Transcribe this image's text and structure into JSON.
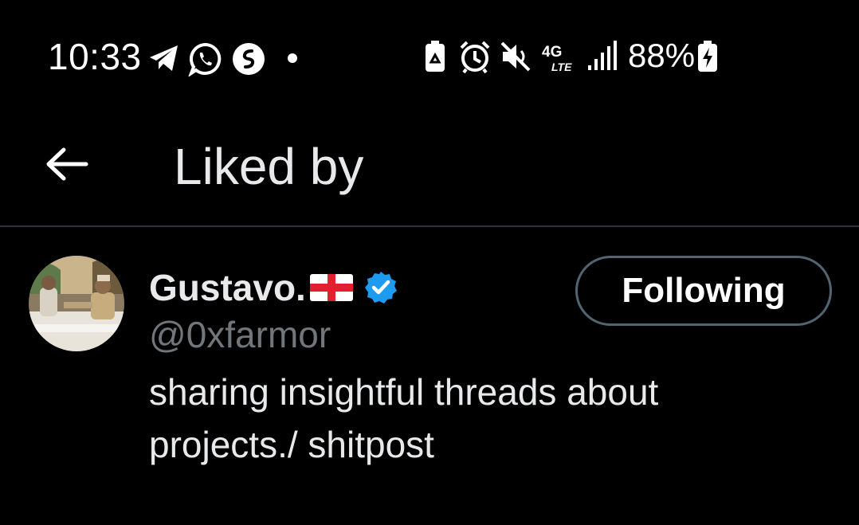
{
  "status_bar": {
    "time": "10:33",
    "battery_percent": "88%",
    "network_label": "4G LTE",
    "left_icons": [
      "telegram-icon",
      "whatsapp-icon",
      "shazam-icon",
      "notification-dot-icon"
    ],
    "right_icons": [
      "battery-saver-icon",
      "alarm-icon",
      "mute-icon",
      "network-4g-lte-icon",
      "signal-icon",
      "battery-charging-icon"
    ]
  },
  "header": {
    "title": "Liked by",
    "back_icon": "arrow-left-icon"
  },
  "users": [
    {
      "display_name": "Gustavo.",
      "flag": "england-flag-icon",
      "verified": true,
      "verified_color": "#1d9bf0",
      "handle": "@0xfarmor",
      "bio": "sharing insightful threads about projects./ shitpost",
      "follow_button_label": "Following"
    }
  ],
  "colors": {
    "background": "#000000",
    "primary_text": "#e7e9ea",
    "secondary_text": "#71767b",
    "divider": "#2f3336",
    "button_border": "#536471",
    "verified_blue": "#1d9bf0"
  }
}
